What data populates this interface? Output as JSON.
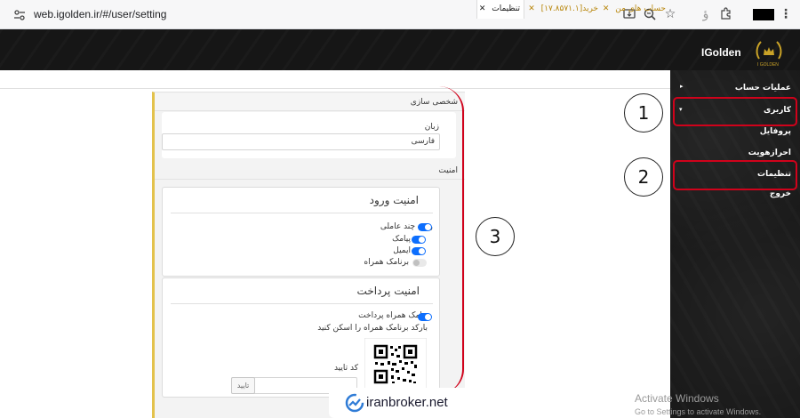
{
  "browser": {
    "url": "web.igolden.ir/#/user/setting",
    "icons": [
      "site-info-icon",
      "install-icon",
      "zoom-icon",
      "star-icon",
      "translate-icon",
      "extensions-icon",
      "menu-icon"
    ]
  },
  "header": {
    "brand": "IGolden",
    "logo_text": "I GOLDEN"
  },
  "sidebar": {
    "items": [
      {
        "label": "عملیات حساب"
      },
      {
        "label": "کاربری"
      },
      {
        "label": "پروفایل"
      },
      {
        "label": "احرازهویت"
      },
      {
        "label": "تنظیمات"
      },
      {
        "label": "خروج"
      }
    ]
  },
  "tabs": [
    {
      "label": "تنظیمات",
      "active": true
    },
    {
      "label": "خرید[۱۷.۸۵۷۱.۱]",
      "active": false
    },
    {
      "label": "حساب های من",
      "active": false
    }
  ],
  "settings": {
    "personalization": {
      "header": "شخصی سازی",
      "language_label": "زبان",
      "language_value": "فارسی"
    },
    "security": {
      "header": "امنیت",
      "login_security": {
        "title": "امنیت ورود",
        "options": [
          {
            "label": "ورود چند عاملی",
            "enabled": true
          },
          {
            "label": "پیامک",
            "enabled": true
          },
          {
            "label": "ایمیل",
            "enabled": true
          },
          {
            "label": "برنامک همراه",
            "enabled": false
          }
        ]
      },
      "payment_security": {
        "title": "امنیت پرداخت",
        "app_toggle_label": "برنامک همراه پرداخت",
        "app_toggle_enabled": true,
        "scan_instruction": "بارکد برنامک همراه را اسکن کنید",
        "code_label": "کد تایید",
        "confirm_button": "تایید"
      }
    }
  },
  "annotations": {
    "callout_1": "1",
    "callout_2": "2",
    "callout_3": "3"
  },
  "watermarks": {
    "windows_title": "Activate Windows",
    "windows_sub": "Go to Settings to activate Windows.",
    "broker": "iranbroker.net"
  },
  "colors": {
    "accent_red": "#d0021b",
    "toggle_blue": "#0d6efd",
    "panel_border_gold": "#e3c24c",
    "header_bg": "#161616"
  }
}
